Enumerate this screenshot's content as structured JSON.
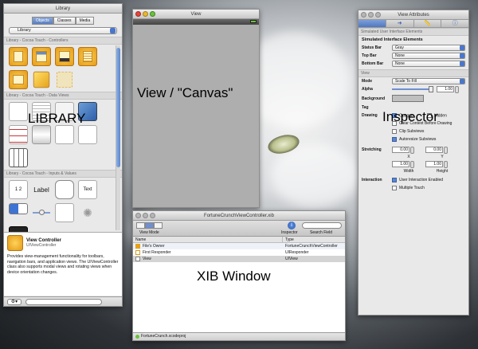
{
  "library": {
    "title": "Library",
    "segments": [
      "Objects",
      "Classes",
      "Media"
    ],
    "active_segment": "Objects",
    "popup_value": "Library",
    "section_controllers": "Library - Cocoa Touch - Controllers",
    "section_data_views": "Library - Cocoa Touch - Data Views",
    "section_inputs": "Library - Cocoa Touch - Inputs & Values",
    "input_tiles": [
      "1 2",
      "Label",
      "",
      "Text"
    ],
    "detail_title": "View Controller",
    "detail_subtitle": "UIViewController",
    "detail_description": "Provides view-management functionality for toolbars, navigation bars, and application views. The UIViewController class also supports modal views and rotating views when device orientation changes."
  },
  "canvas": {
    "title": "View"
  },
  "inspector": {
    "title": "View Attributes",
    "section_simulated": "Simulated User Interface Elements",
    "simulated_heading": "Simulated Interface Elements",
    "status_bar_label": "Status Bar",
    "status_bar_value": "Gray",
    "top_bar_label": "Top Bar",
    "top_bar_value": "None",
    "bottom_bar_label": "Bottom Bar",
    "bottom_bar_value": "None",
    "section_view": "View",
    "mode_label": "Mode",
    "mode_value": "Scale To Fill",
    "alpha_label": "Alpha",
    "alpha_value": "1.00",
    "background_label": "Background",
    "tag_label": "Tag",
    "drawing_label": "Drawing",
    "opaque": "Opaque",
    "hidden": "Hidden",
    "clear_context": "Clear Context Before Drawing",
    "clip_subviews": "Clip Subviews",
    "autoresize": "Autoresize Subviews",
    "stretching_label": "Stretching",
    "stretch_x": "0.00",
    "stretch_y": "0.00",
    "stretch_w": "1.00",
    "stretch_h": "1.00",
    "x_label": "X",
    "y_label": "Y",
    "width_label": "Width",
    "height_label": "Height",
    "interaction_label": "Interaction",
    "user_interaction": "User Interaction Enabled",
    "multiple_touch": "Multiple Touch"
  },
  "xib": {
    "title": "FortuneCrunchViewController.xib",
    "view_mode_label": "View Mode",
    "inspector_label": "Inspector",
    "search_label": "Search Field",
    "col_name": "Name",
    "col_type": "Type",
    "rows": [
      {
        "name": "File's Owner",
        "type": "FortuneCrunchViewController"
      },
      {
        "name": "First Responder",
        "type": "UIResponder"
      },
      {
        "name": "View",
        "type": "UIView"
      }
    ],
    "footer": "FortuneCrunch.xcodeproj"
  },
  "labels": {
    "library": "LIBRARY",
    "canvas": "View / \"Canvas\"",
    "inspector": "Inspector",
    "xib": "XIB Window"
  }
}
